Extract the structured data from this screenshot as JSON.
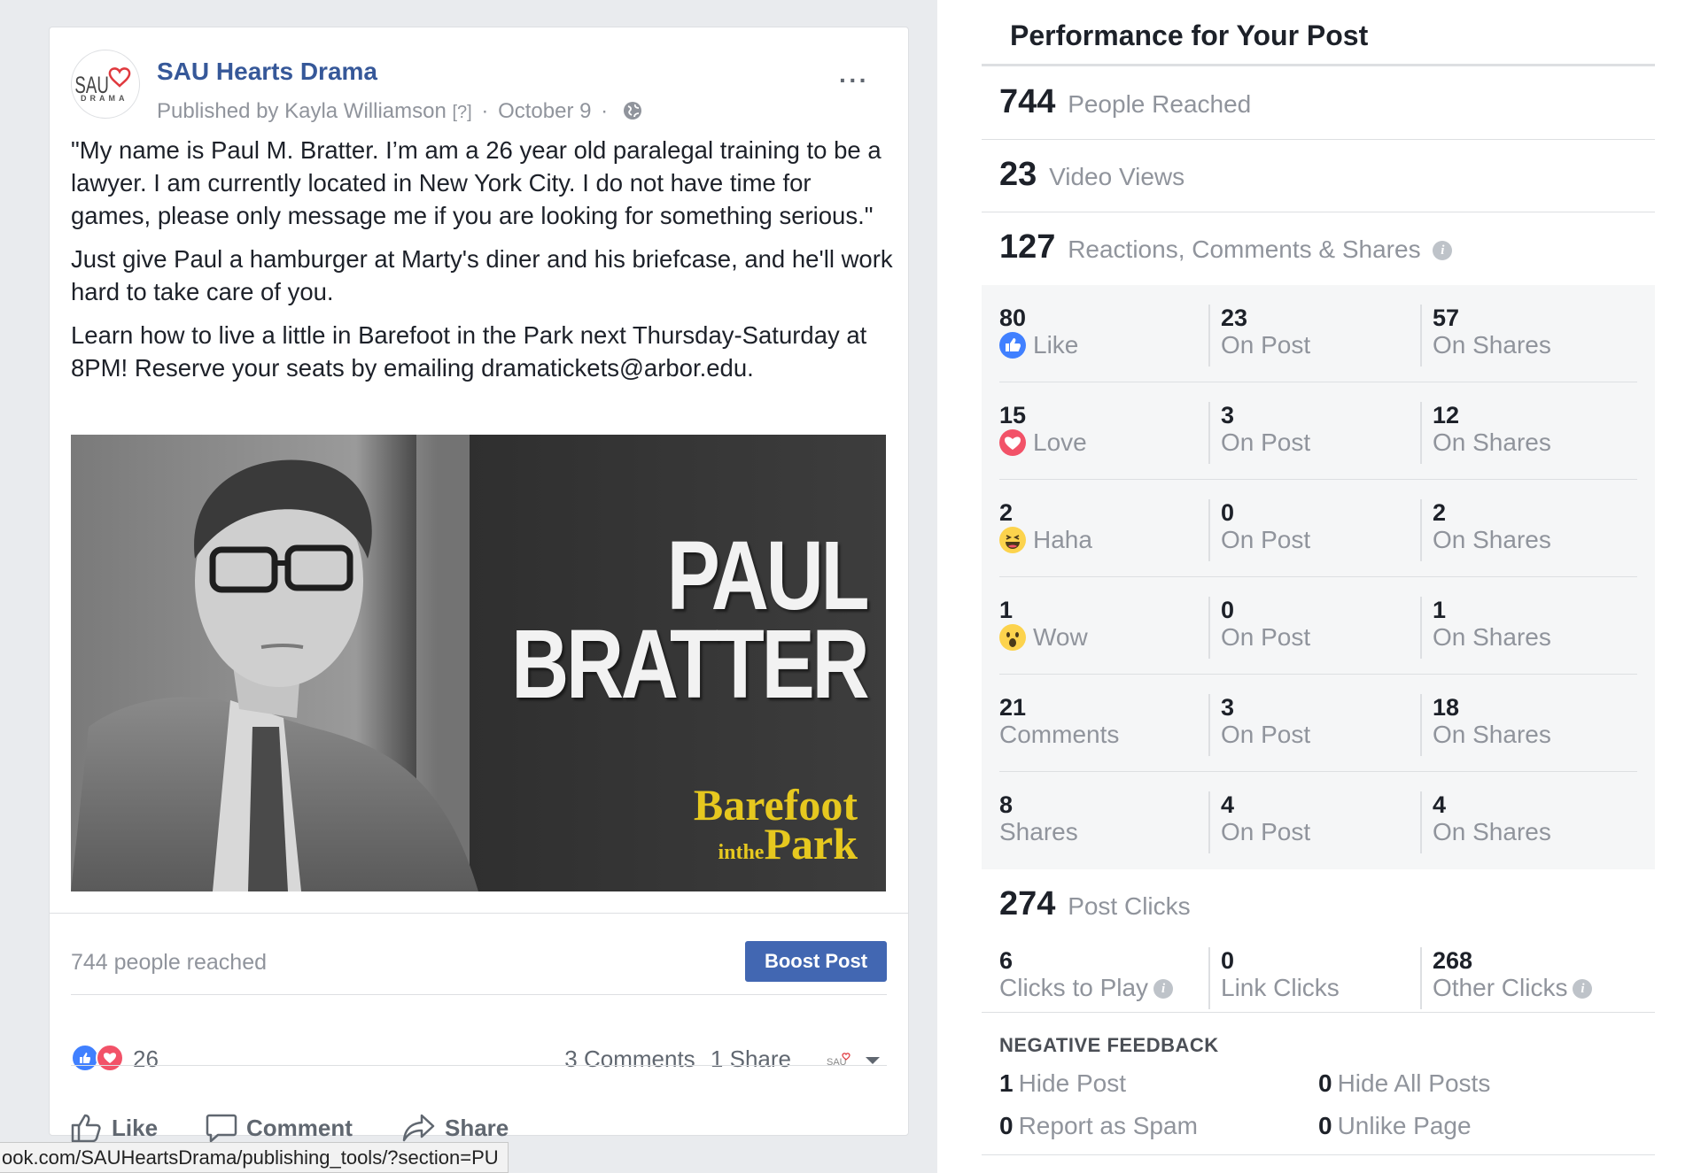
{
  "post": {
    "page_name": "SAU Hearts Drama",
    "published_by": "Published by Kayla Williamson",
    "help_marker": "[?]",
    "date": "October 9",
    "more_label": "···",
    "avatar": {
      "line1": "SAU",
      "line2": "DRAMA",
      "heart_color": "#e0393e"
    },
    "paragraphs": [
      "\"My name is Paul M. Bratter. I’m am a 26 year old paralegal training to be a lawyer. I am currently located in New York City. I do not have time for games, please only message me if you are looking for something serious.\"",
      "Just give Paul a hamburger at Marty's diner and his briefcase, and he'll work hard to take care of you.",
      "Learn how to live a little in Barefoot in the Park next Thursday-Saturday at 8PM! Reserve your seats by emailing dramatickets@arbor.edu."
    ],
    "image": {
      "title_line1": "PAUL",
      "title_line2": "BRATTER",
      "logo_line1": "Barefoot",
      "logo_in": "in",
      "logo_the": "the",
      "logo_line2": "Park"
    },
    "reach_text": "744 people reached",
    "boost_label": "Boost Post",
    "reaction_count": "26",
    "comments_label": "3 Comments",
    "shares_label": "1 Share",
    "actions": {
      "like": "Like",
      "comment": "Comment",
      "share": "Share"
    }
  },
  "status_url": "ook.com/SAUHeartsDrama/publishing_tools/?section=PU",
  "performance": {
    "title": "Performance for Your Post",
    "people_reached": {
      "value": "744",
      "label": "People Reached"
    },
    "video_views": {
      "value": "23",
      "label": "Video Views"
    },
    "engagement": {
      "value": "127",
      "label": "Reactions, Comments & Shares"
    },
    "rows": [
      {
        "total": "80",
        "label": "Like",
        "icon": "like",
        "on_post": "23",
        "on_shares": "57"
      },
      {
        "total": "15",
        "label": "Love",
        "icon": "love",
        "on_post": "3",
        "on_shares": "12"
      },
      {
        "total": "2",
        "label": "Haha",
        "icon": "haha",
        "on_post": "0",
        "on_shares": "2"
      },
      {
        "total": "1",
        "label": "Wow",
        "icon": "wow",
        "on_post": "0",
        "on_shares": "1"
      },
      {
        "total": "21",
        "label": "Comments",
        "icon": "",
        "on_post": "3",
        "on_shares": "18"
      },
      {
        "total": "8",
        "label": "Shares",
        "icon": "",
        "on_post": "4",
        "on_shares": "4"
      }
    ],
    "on_post_label": "On Post",
    "on_shares_label": "On Shares",
    "post_clicks": {
      "value": "274",
      "label": "Post Clicks"
    },
    "clicks": [
      {
        "value": "6",
        "label": "Clicks to Play",
        "info": true
      },
      {
        "value": "0",
        "label": "Link Clicks",
        "info": false
      },
      {
        "value": "268",
        "label": "Other Clicks",
        "info": true
      }
    ],
    "negative_title": "NEGATIVE FEEDBACK",
    "negative": [
      {
        "value": "1",
        "label": "Hide Post"
      },
      {
        "value": "0",
        "label": "Hide All Posts"
      },
      {
        "value": "0",
        "label": "Report as Spam"
      },
      {
        "value": "0",
        "label": "Unlike Page"
      }
    ],
    "colors": {
      "like_blue": "#4080ff",
      "love_red": "#f25268",
      "haha_yellow": "#fcd34d",
      "brand": "#4267b2"
    }
  }
}
